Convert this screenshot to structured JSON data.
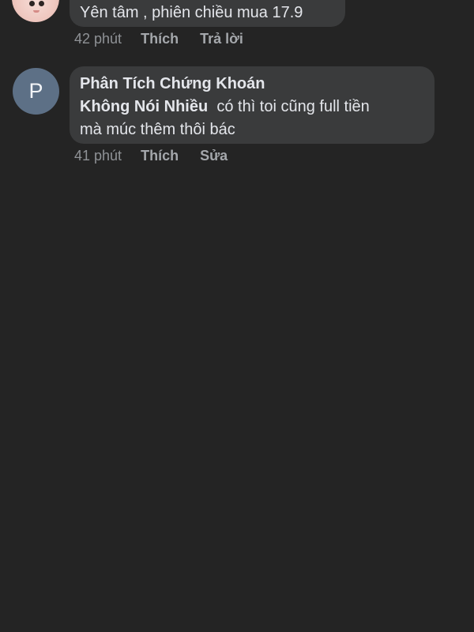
{
  "comments": [
    {
      "avatar": "profile-photo",
      "text": "Yên tâm , phiên chiều mua 17.9",
      "time": "42 phút",
      "like_label": "Thích",
      "secondary_label": "Trả lời"
    },
    {
      "avatar_letter": "P",
      "author_line1": "Phân Tích Chứng Khoán",
      "author_line2": "Không Nói Nhiều",
      "text_line1": "có thì toi cũng full tiền",
      "text_line2": "mà múc thêm thôi bác",
      "time": "41 phút",
      "like_label": "Thích",
      "secondary_label": "Sửa"
    }
  ],
  "colors": {
    "background": "#242424",
    "bubble": "#3a3b3c",
    "avatar_letter_bg": "#5d7086"
  }
}
